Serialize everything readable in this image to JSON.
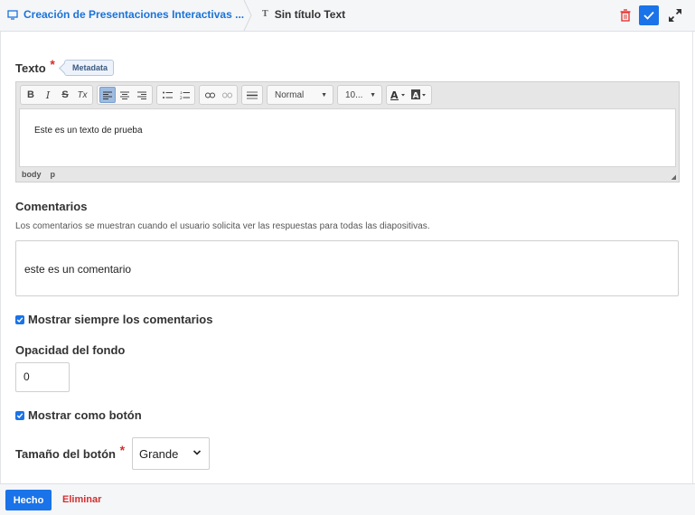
{
  "topbar": {
    "breadcrumb_link": "Creación de Presentaciones Interactivas ...",
    "current_title": "Sin título Text",
    "current_glyph": "T",
    "icons": [
      "presentation-icon",
      "type-t-icon",
      "trash-icon",
      "check-icon",
      "expand-icon"
    ],
    "colors": {
      "accent": "#1a73e8",
      "danger": "#e53935"
    }
  },
  "texto": {
    "label": "Texto",
    "required_mark": "*",
    "metadata_tag": "Metadata",
    "toolbar": {
      "bold": "B",
      "italic": "I",
      "strike": "S",
      "clear_format": "Tx",
      "format_select": "Normal",
      "size_select": "10..."
    },
    "content": "Este es un texto de prueba",
    "path": [
      "body",
      "p"
    ]
  },
  "comentarios": {
    "label": "Comentarios",
    "description": "Los comentarios se muestran cuando el usuario solicita ver las respuestas para todas las diapositivas.",
    "value": "este es un comentario"
  },
  "always_show": {
    "label": "Mostrar siempre los comentarios",
    "checked": true
  },
  "opacity": {
    "label": "Opacidad del fondo",
    "value": "0"
  },
  "as_button": {
    "label": "Mostrar como botón",
    "checked": true
  },
  "button_size": {
    "label": "Tamaño del botón",
    "required_mark": "*",
    "value": "Grande"
  },
  "bottombar": {
    "done_label": "Hecho",
    "remove_label": "Eliminar"
  }
}
